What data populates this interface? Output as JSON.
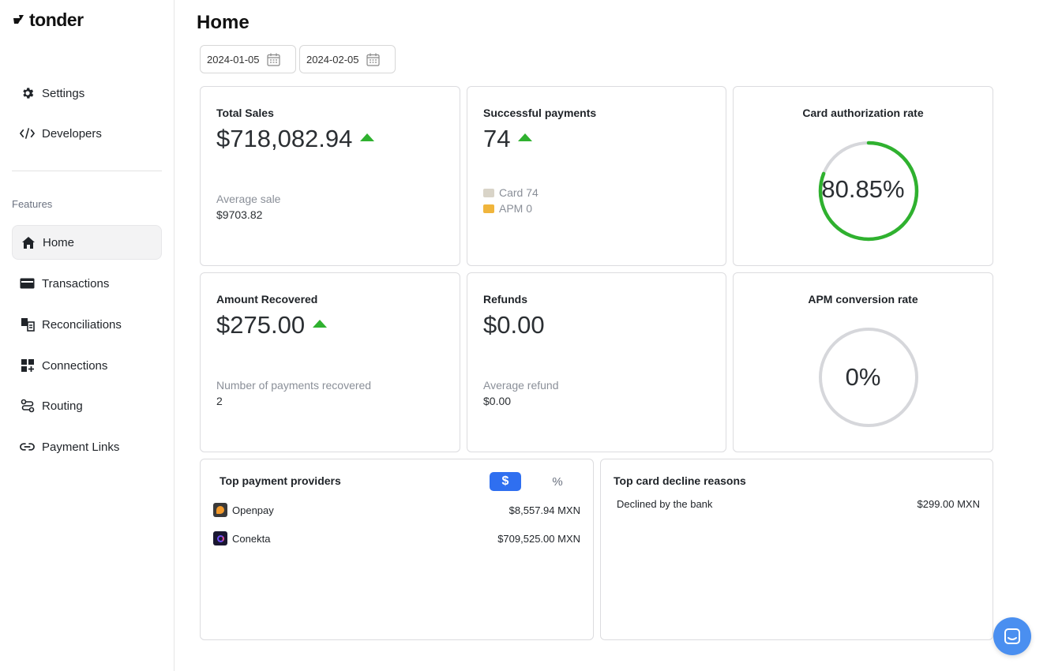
{
  "app": {
    "name": "tonder"
  },
  "sidebar": {
    "top_items": [
      {
        "label": "Settings",
        "icon": "gear-icon"
      },
      {
        "label": "Developers",
        "icon": "code-icon"
      }
    ],
    "section_label": "Features",
    "items": [
      {
        "label": "Home",
        "icon": "home-icon",
        "active": true
      },
      {
        "label": "Transactions",
        "icon": "card-icon"
      },
      {
        "label": "Reconciliations",
        "icon": "reconcile-icon"
      },
      {
        "label": "Connections",
        "icon": "connections-icon"
      },
      {
        "label": "Routing",
        "icon": "routing-icon"
      },
      {
        "label": "Payment Links",
        "icon": "link-icon"
      }
    ]
  },
  "header": {
    "title": "Home"
  },
  "filters": {
    "start_date": "2024-01-05",
    "end_date": "2024-02-05"
  },
  "cards": {
    "total_sales": {
      "title": "Total Sales",
      "value": "$718,082.94",
      "trend": "up",
      "sub_label": "Average sale",
      "sub_value": "$9703.82"
    },
    "successful_payments": {
      "title": "Successful payments",
      "value": "74",
      "trend": "up",
      "card_line": "Card 74",
      "apm_line": "APM 0"
    },
    "card_auth_rate": {
      "title": "Card authorization rate",
      "value": "80.85%",
      "fraction": 0.8085,
      "color": "#2fb12f"
    },
    "amount_recovered": {
      "title": "Amount Recovered",
      "value": "$275.00",
      "trend": "up",
      "sub_label": "Number of payments recovered",
      "sub_value": "2"
    },
    "refunds": {
      "title": "Refunds",
      "value": "$0.00",
      "sub_label": "Average refund",
      "sub_value": "$0.00"
    },
    "apm_conversion_rate": {
      "title": "APM conversion rate",
      "value": "0%",
      "fraction": 0
    }
  },
  "top_providers": {
    "title": "Top payment providers",
    "toggle_currency": "$",
    "toggle_percent": "%",
    "rows": [
      {
        "name": "Openpay",
        "amount": "$8,557.94 MXN"
      },
      {
        "name": "Conekta",
        "amount": "$709,525.00 MXN"
      }
    ]
  },
  "decline_reasons": {
    "title": "Top card decline reasons",
    "rows": [
      {
        "reason": "Declined by the bank",
        "amount": "$299.00 MXN"
      }
    ]
  },
  "colors": {
    "accent": "#2f6ff0",
    "success": "#2fb12f",
    "chat": "#4a8ff0"
  }
}
